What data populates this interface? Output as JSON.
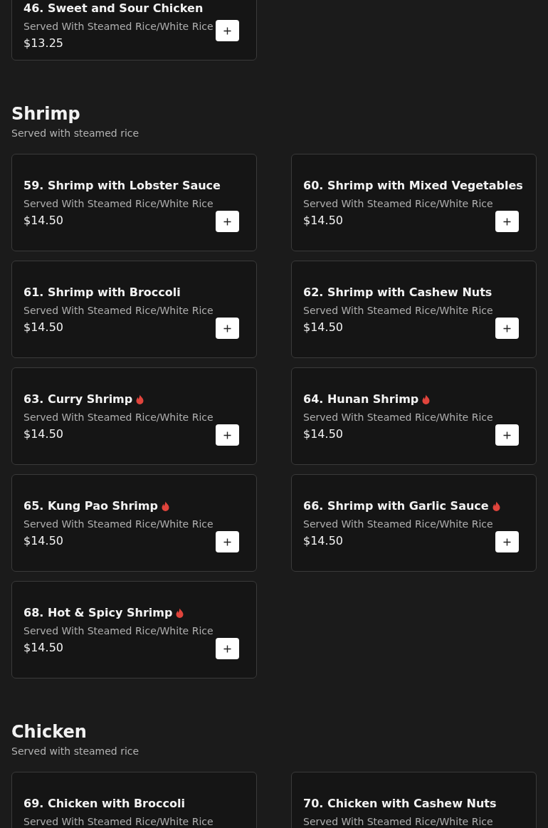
{
  "sections": [
    {
      "items": [
        {
          "name": "46. Sweet and Sour Chicken",
          "description": "Served With Steamed Rice/White Rice",
          "price": "$13.25",
          "spicy": false
        }
      ]
    },
    {
      "title": "Shrimp",
      "subtitle": "Served with steamed rice",
      "items": [
        {
          "name": "59. Shrimp with Lobster Sauce",
          "description": "Served With Steamed Rice/White Rice",
          "price": "$14.50",
          "spicy": false
        },
        {
          "name": "60. Shrimp with Mixed Vegetables",
          "description": "Served With Steamed Rice/White Rice",
          "price": "$14.50",
          "spicy": false
        },
        {
          "name": "61. Shrimp with Broccoli",
          "description": "Served With Steamed Rice/White Rice",
          "price": "$14.50",
          "spicy": false
        },
        {
          "name": "62. Shrimp with Cashew Nuts",
          "description": "Served With Steamed Rice/White Rice",
          "price": "$14.50",
          "spicy": false
        },
        {
          "name": "63. Curry Shrimp",
          "description": "Served With Steamed Rice/White Rice",
          "price": "$14.50",
          "spicy": true
        },
        {
          "name": "64. Hunan Shrimp",
          "description": "Served With Steamed Rice/White Rice",
          "price": "$14.50",
          "spicy": true
        },
        {
          "name": "65. Kung Pao Shrimp",
          "description": "Served With Steamed Rice/White Rice",
          "price": "$14.50",
          "spicy": true
        },
        {
          "name": "66. Shrimp with Garlic Sauce",
          "description": "Served With Steamed Rice/White Rice",
          "price": "$14.50",
          "spicy": true
        },
        {
          "name": "68. Hot & Spicy Shrimp",
          "description": "Served With Steamed Rice/White Rice",
          "price": "$14.50",
          "spicy": true
        }
      ]
    },
    {
      "title": "Chicken",
      "subtitle": "Served with steamed rice",
      "items": [
        {
          "name": "69. Chicken with Broccoli",
          "description": "Served With Steamed Rice/White Rice",
          "spicy": false
        },
        {
          "name": "70. Chicken with Cashew Nuts",
          "description": "Served With Steamed Rice/White Rice",
          "spicy": false
        }
      ]
    }
  ]
}
